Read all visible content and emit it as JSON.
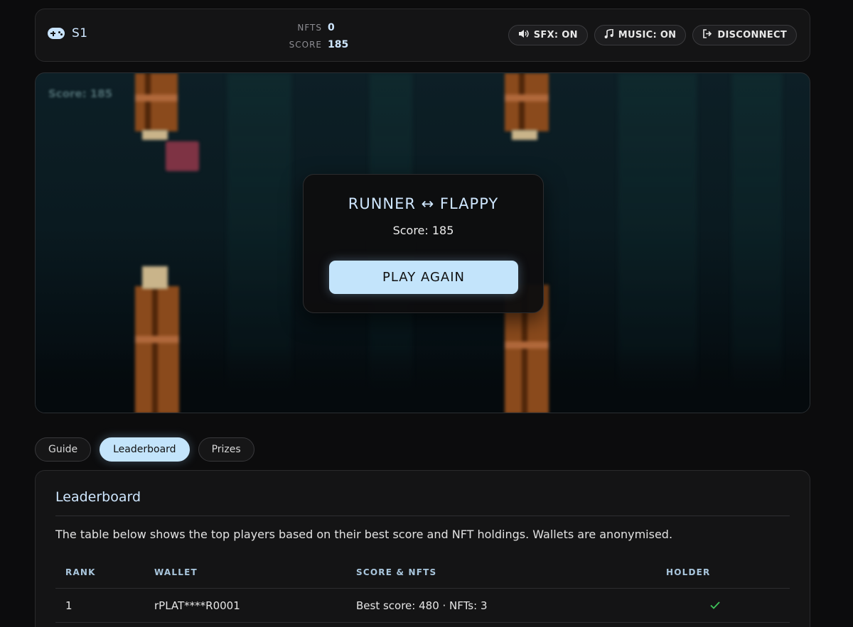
{
  "header": {
    "brand_label": "S1",
    "stats": [
      {
        "label": "NFTS",
        "value": "0"
      },
      {
        "label": "SCORE",
        "value": "185"
      }
    ],
    "controls": [
      {
        "label": "SFX: ON",
        "icon": "speaker-icon"
      },
      {
        "label": "MUSIC: ON",
        "icon": "music-note-icon"
      },
      {
        "label": "DISCONNECT",
        "icon": "logout-icon"
      }
    ]
  },
  "game": {
    "hud_score": "Score: 185",
    "modal": {
      "title": "RUNNER ↔ FLAPPY",
      "score": "Score: 185",
      "play_again": "PLAY AGAIN"
    }
  },
  "tabs": [
    {
      "label": "Guide",
      "active": false
    },
    {
      "label": "Leaderboard",
      "active": true
    },
    {
      "label": "Prizes",
      "active": false
    }
  ],
  "leaderboard": {
    "title": "Leaderboard",
    "description": "The table below shows the top players based on their best score and NFT holdings. Wallets are anonymised.",
    "columns": [
      "RANK",
      "WALLET",
      "SCORE & NFTS",
      "HOLDER"
    ],
    "rows": [
      {
        "rank": "1",
        "wallet": "rPLAT****R0001",
        "score_nfts": "Best score: 480 · NFTs: 3",
        "holder": true
      }
    ]
  },
  "colors": {
    "accent": "#c3e4fb",
    "accent_text": "#cfe7ff",
    "holder_check": "#3fc45a",
    "background": "#0c0c0d"
  }
}
